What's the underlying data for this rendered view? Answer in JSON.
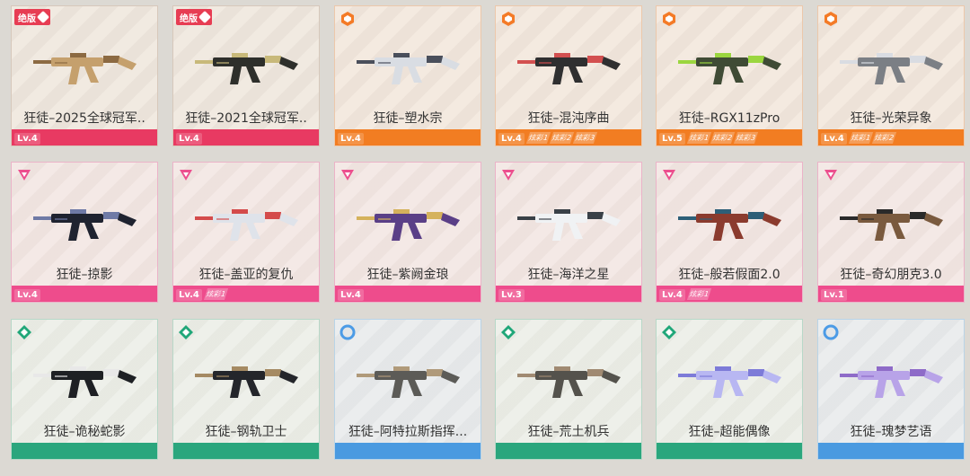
{
  "cards": [
    {
      "name": "狂徒–2025全球冠军..",
      "level": "Lv.4",
      "badge": "绝版",
      "theme": "red",
      "rarity": "gold",
      "tags": [],
      "gunColor": "#c5a06d",
      "accent": "#8c6a42"
    },
    {
      "name": "狂徒–2021全球冠军..",
      "level": "Lv.4",
      "badge": "绝版",
      "theme": "red",
      "rarity": "gold",
      "tags": [],
      "gunColor": "#2e2f2b",
      "accent": "#c8b97a"
    },
    {
      "name": "狂徒–塑水宗",
      "level": "Lv.4",
      "badge": "",
      "theme": "orange",
      "rarity": "orange",
      "tags": [],
      "gunColor": "#d9dde3",
      "accent": "#4a4f5b"
    },
    {
      "name": "狂徒–混沌序曲",
      "level": "Lv.4",
      "badge": "",
      "theme": "orange",
      "rarity": "orange",
      "tags": [
        "炫彩1",
        "炫彩2",
        "炫彩3"
      ],
      "gunColor": "#2f2f30",
      "accent": "#d35050"
    },
    {
      "name": "狂徒–RGX11zPro",
      "level": "Lv.5",
      "badge": "",
      "theme": "orange",
      "rarity": "orange",
      "tags": [
        "炫彩1",
        "炫彩2",
        "炫彩3"
      ],
      "gunColor": "#3f4b35",
      "accent": "#9bd63f"
    },
    {
      "name": "狂徒–光荣异象",
      "level": "Lv.4",
      "badge": "",
      "theme": "orange",
      "rarity": "orange",
      "tags": [
        "炫彩1",
        "炫彩2"
      ],
      "gunColor": "#7b7f85",
      "accent": "#d9dce2"
    },
    {
      "name": "狂徒–掠影",
      "level": "Lv.4",
      "badge": "",
      "theme": "pink",
      "rarity": "pink",
      "tags": [],
      "gunColor": "#1f2330",
      "accent": "#6f7aa6"
    },
    {
      "name": "狂徒–盖亚的复仇",
      "level": "Lv.4",
      "badge": "",
      "theme": "pink",
      "rarity": "pink",
      "tags": [
        "炫彩1"
      ],
      "gunColor": "#dfe3ea",
      "accent": "#d44b4b"
    },
    {
      "name": "狂徒–紫阙金琅",
      "level": "Lv.4",
      "badge": "",
      "theme": "pink",
      "rarity": "pink",
      "tags": [],
      "gunColor": "#5a3f87",
      "accent": "#d5b25c"
    },
    {
      "name": "狂徒–海洋之星",
      "level": "Lv.3",
      "badge": "",
      "theme": "pink",
      "rarity": "pink",
      "tags": [],
      "gunColor": "#f0f2f4",
      "accent": "#394047"
    },
    {
      "name": "狂徒–般若假面2.0",
      "level": "Lv.4",
      "badge": "",
      "theme": "pink",
      "rarity": "pink",
      "tags": [
        "炫彩1"
      ],
      "gunColor": "#8b3b2e",
      "accent": "#2d5f78"
    },
    {
      "name": "狂徒–奇幻朋克3.0",
      "level": "Lv.1",
      "badge": "",
      "theme": "pink",
      "rarity": "pink",
      "tags": [],
      "gunColor": "#7a5a3e",
      "accent": "#2a2a2a"
    },
    {
      "name": "狂徒–诡秘蛇影",
      "level": "",
      "badge": "",
      "theme": "green",
      "rarity": "green",
      "tags": [],
      "gunColor": "#1e2024",
      "accent": "#e8e8e8"
    },
    {
      "name": "狂徒–钢轨卫士",
      "level": "",
      "badge": "",
      "theme": "green",
      "rarity": "green",
      "tags": [],
      "gunColor": "#24262b",
      "accent": "#a58a63"
    },
    {
      "name": "狂徒–阿特拉斯指挥...",
      "level": "",
      "badge": "",
      "theme": "blue",
      "rarity": "blue",
      "tags": [],
      "gunColor": "#5c5b57",
      "accent": "#b09a7a"
    },
    {
      "name": "狂徒–荒土机兵",
      "level": "",
      "badge": "",
      "theme": "green",
      "rarity": "green",
      "tags": [],
      "gunColor": "#54524c",
      "accent": "#a08a72"
    },
    {
      "name": "狂徒–超能偶像",
      "level": "",
      "badge": "",
      "theme": "green",
      "rarity": "green",
      "tags": [],
      "gunColor": "#b8b7f2",
      "accent": "#7d7bd8"
    },
    {
      "name": "狂徒–瑰梦艺语",
      "level": "",
      "badge": "",
      "theme": "blue",
      "rarity": "blue",
      "tags": [],
      "gunColor": "#b8a3e8",
      "accent": "#8e6bc8"
    }
  ],
  "icons": {
    "red": "hexagon-badge-icon",
    "orange": "shield-icon",
    "pink": "triangle-icon",
    "green": "diamond-icon",
    "blue": "ring-icon"
  }
}
